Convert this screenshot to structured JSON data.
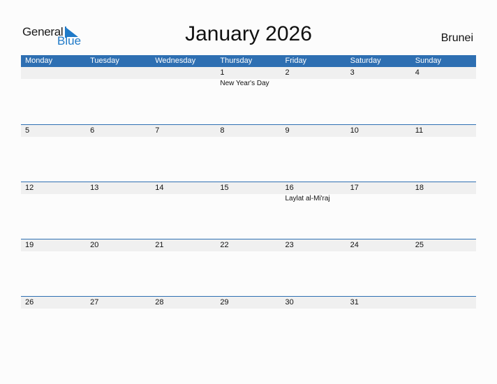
{
  "brand": {
    "line1": "General",
    "line2": "Blue",
    "color": "#1f7ac8"
  },
  "title": "January 2026",
  "country": "Brunei",
  "header_color": "#2e6fb2",
  "weekdays": [
    "Monday",
    "Tuesday",
    "Wednesday",
    "Thursday",
    "Friday",
    "Saturday",
    "Sunday"
  ],
  "weeks": [
    {
      "days": [
        "",
        "",
        "",
        "1",
        "2",
        "3",
        "4"
      ],
      "events": [
        "",
        "",
        "",
        "New Year's Day",
        "",
        "",
        ""
      ]
    },
    {
      "days": [
        "5",
        "6",
        "7",
        "8",
        "9",
        "10",
        "11"
      ],
      "events": [
        "",
        "",
        "",
        "",
        "",
        "",
        ""
      ]
    },
    {
      "days": [
        "12",
        "13",
        "14",
        "15",
        "16",
        "17",
        "18"
      ],
      "events": [
        "",
        "",
        "",
        "",
        "Laylat al-Mi'raj",
        "",
        ""
      ]
    },
    {
      "days": [
        "19",
        "20",
        "21",
        "22",
        "23",
        "24",
        "25"
      ],
      "events": [
        "",
        "",
        "",
        "",
        "",
        "",
        ""
      ]
    },
    {
      "days": [
        "26",
        "27",
        "28",
        "29",
        "30",
        "31",
        ""
      ],
      "events": [
        "",
        "",
        "",
        "",
        "",
        "",
        ""
      ]
    }
  ]
}
